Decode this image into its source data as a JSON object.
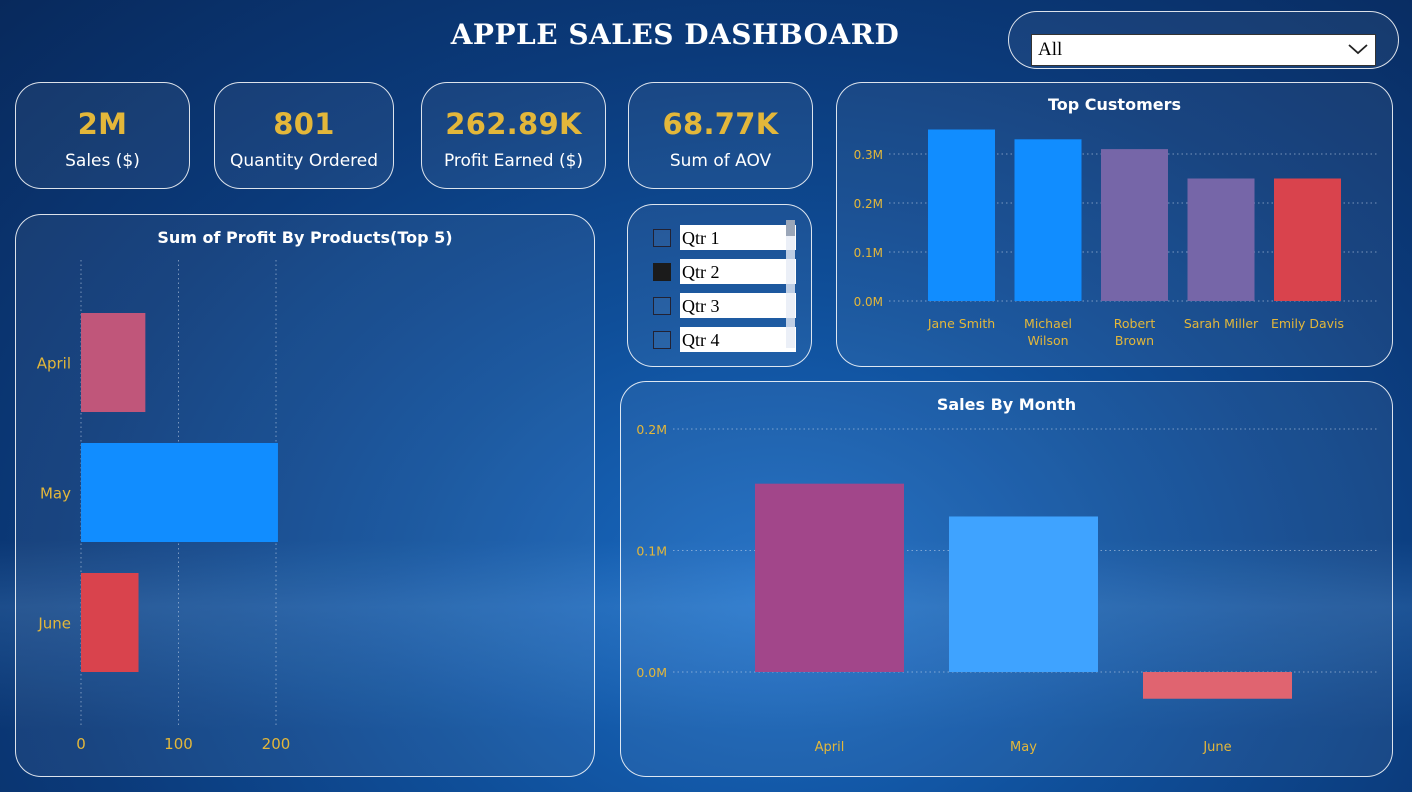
{
  "header": {
    "title": "APPLE SALES DASHBOARD"
  },
  "filter": {
    "selected": "All"
  },
  "kpis": [
    {
      "value": "2M",
      "label": "Sales ($)"
    },
    {
      "value": "801",
      "label": "Quantity Ordered"
    },
    {
      "value": "262.89K",
      "label": "Profit Earned ($)"
    },
    {
      "value": "68.77K",
      "label": "Sum of AOV"
    }
  ],
  "quarters": {
    "items": [
      {
        "label": "Qtr 1",
        "checked": false
      },
      {
        "label": "Qtr 2",
        "checked": true
      },
      {
        "label": "Qtr 3",
        "checked": false
      },
      {
        "label": "Qtr 4",
        "checked": false
      }
    ]
  },
  "colors": {
    "accent_gold": "#e3b73a",
    "blue": "#118dff",
    "purple": "#7666a8",
    "red": "#d9434d",
    "pink": "#c0567a",
    "magenta": "#a2468a",
    "light_blue": "#3fa3ff",
    "light_red": "#e06470"
  },
  "chart_data": [
    {
      "id": "profit-by-products",
      "type": "bar",
      "orientation": "horizontal",
      "title": "Sum of Profit By Products(Top 5)",
      "categories": [
        "April",
        "May",
        "June"
      ],
      "values": [
        66,
        202,
        59
      ],
      "colors": [
        "#c0567a",
        "#118dff",
        "#d9434d"
      ],
      "xlim": [
        0,
        200
      ],
      "xticks": [
        "0",
        "100",
        "200"
      ],
      "grid": true
    },
    {
      "id": "top-customers",
      "type": "bar",
      "title": "Top Customers",
      "categories": [
        "Jane Smith",
        "Michael Wilson",
        "Robert Brown",
        "Sarah Miller",
        "Emily Davis"
      ],
      "values": [
        0.35,
        0.33,
        0.31,
        0.25,
        0.25
      ],
      "colors": [
        "#118dff",
        "#118dff",
        "#7666a8",
        "#7666a8",
        "#d9434d"
      ],
      "unit": "M",
      "ylim": [
        0,
        0.3
      ],
      "yticks": [
        "0.0M",
        "0.1M",
        "0.2M",
        "0.3M"
      ],
      "grid": true
    },
    {
      "id": "sales-by-month",
      "type": "bar",
      "title": "Sales By Month",
      "categories": [
        "April",
        "May",
        "June"
      ],
      "values": [
        0.155,
        0.128,
        -0.022
      ],
      "colors": [
        "#a2468a",
        "#3fa3ff",
        "#e06470"
      ],
      "unit": "M",
      "ylim": [
        0,
        0.2
      ],
      "yticks": [
        "0.0M",
        "0.1M",
        "0.2M"
      ],
      "grid": true
    }
  ]
}
